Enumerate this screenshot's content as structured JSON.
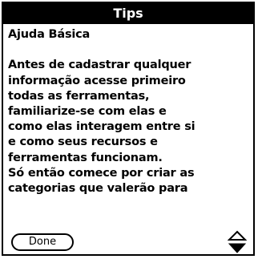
{
  "dialog": {
    "title": "Tips",
    "heading": "Ajuda Básica",
    "paragraph_lines": [
      "Antes de cadastrar qualquer",
      "informação acesse primeiro",
      "todas as ferramentas,",
      "familiarize-se com elas e",
      "como elas interagem entre si",
      "e como seus recursos e",
      "ferramentas funcionam.",
      "Só então comece por criar as",
      "categorias que valerão para"
    ],
    "done_label": "Done"
  },
  "icons": {
    "scroll_up": "scroll-up-arrow-icon",
    "scroll_down": "scroll-down-arrow-icon"
  }
}
